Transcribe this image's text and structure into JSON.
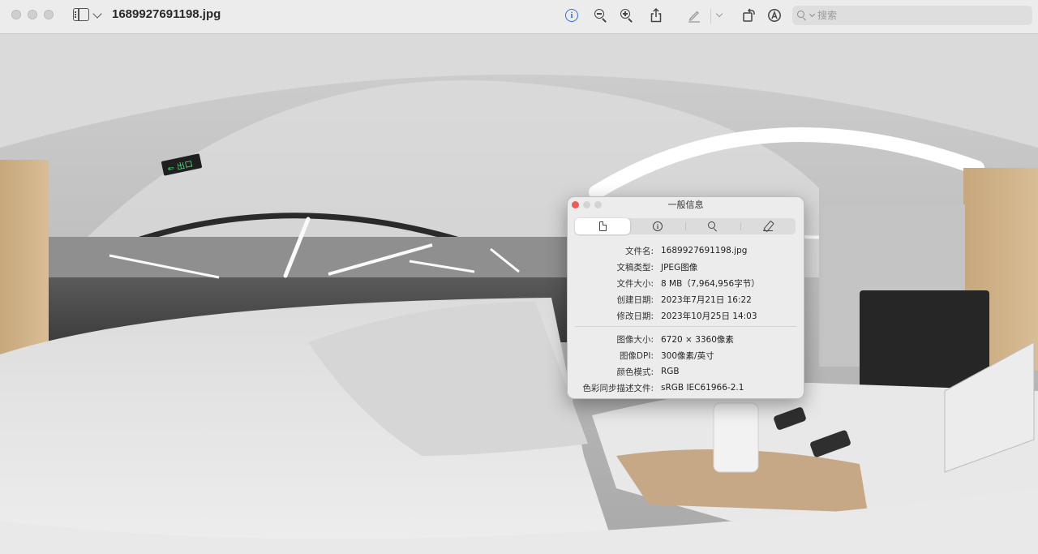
{
  "window": {
    "title": "1689927691198.jpg"
  },
  "toolbar": {
    "icons": [
      "sidebar-icon",
      "chevron-down-icon",
      "info-icon",
      "zoom-out-icon",
      "zoom-in-icon",
      "share-icon",
      "markup-pen-icon",
      "chevron-down-icon",
      "rotate-icon",
      "markup-circle-icon"
    ],
    "search_placeholder": "搜索",
    "accent_color": "#2f6fe0"
  },
  "info_panel": {
    "title": "一般信息",
    "tabs": [
      "document-icon",
      "info-icon",
      "search-icon",
      "pen-icon"
    ],
    "active_tab": 0,
    "general": [
      {
        "label": "文件名:",
        "value": "1689927691198.jpg"
      },
      {
        "label": "文稿类型:",
        "value": "JPEG图像"
      },
      {
        "label": "文件大小:",
        "value": "8 MB（7,964,956字节）"
      },
      {
        "label": "创建日期:",
        "value": "2023年7月21日 16:22"
      },
      {
        "label": "修改日期:",
        "value": "2023年10月25日 14:03"
      }
    ],
    "image": [
      {
        "label": "图像大小:",
        "value": "6720 × 3360像素"
      },
      {
        "label": "图像DPI:",
        "value": "300像素/英寸"
      },
      {
        "label": "颜色模式:",
        "value": "RGB"
      },
      {
        "label": "色彩同步描述文件:",
        "value": "sRGB IEC61966-2.1"
      }
    ]
  },
  "image_content": {
    "sign_text": "⇐ 出口"
  }
}
